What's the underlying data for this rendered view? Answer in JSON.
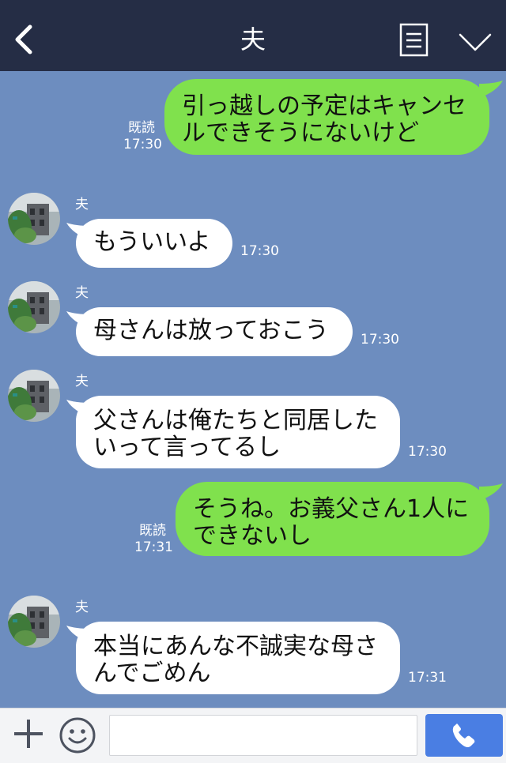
{
  "header": {
    "title": "夫"
  },
  "messages": [
    {
      "direction": "outgoing",
      "lines": [
        "引っ越しの予定はキャンセ",
        "ルできそうにないけど"
      ],
      "read_label": "既読",
      "time": "17:30"
    },
    {
      "direction": "incoming",
      "sender": "夫",
      "lines": [
        "もういいよ"
      ],
      "time": "17:30"
    },
    {
      "direction": "incoming",
      "sender": "夫",
      "lines": [
        "母さんは放っておこう"
      ],
      "time": "17:30"
    },
    {
      "direction": "incoming",
      "sender": "夫",
      "lines": [
        "父さんは俺たちと同居した",
        "いって言ってるし"
      ],
      "time": "17:30"
    },
    {
      "direction": "outgoing",
      "lines": [
        "そうね。お義父さん1人に",
        "できないし"
      ],
      "read_label": "既読",
      "time": "17:31"
    },
    {
      "direction": "incoming",
      "sender": "夫",
      "lines": [
        "本当にあんな不誠実な母さ",
        "んでごめん"
      ],
      "time": "17:31"
    }
  ],
  "input": {
    "value": "",
    "placeholder": ""
  },
  "icons": {
    "back": "chevron-left-icon",
    "menu": "document-menu-icon",
    "collapse": "chevron-down-icon",
    "plus": "plus-icon",
    "emoji": "smiley-icon",
    "call": "phone-icon"
  },
  "colors": {
    "header": "#252d45",
    "chat_background": "#6d8dbf",
    "outgoing_bubble": "#80e14d",
    "incoming_bubble": "#ffffff",
    "call_button": "#4a7ee3"
  }
}
